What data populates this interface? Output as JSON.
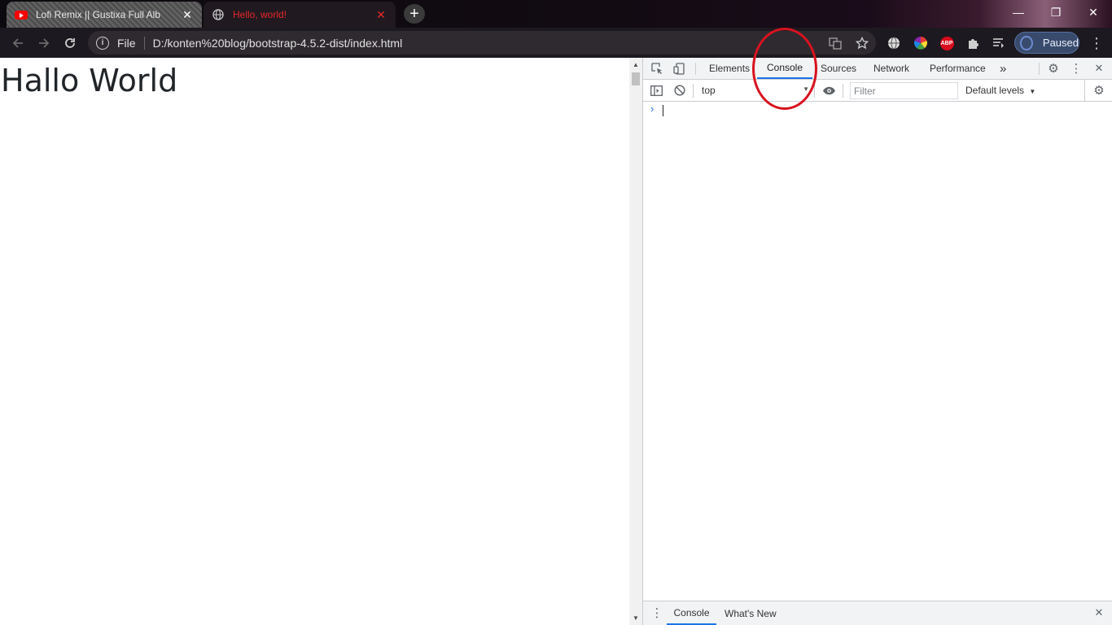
{
  "browser": {
    "tabs": [
      {
        "title": "Lofi Remix || Gustixa Full Alb",
        "favicon": "youtube-icon"
      },
      {
        "title": "Hello, world!",
        "favicon": "globe-icon"
      }
    ],
    "new_tab_label": "+",
    "window_controls": {
      "minimize": "—",
      "restore": "❐",
      "close": "✕"
    },
    "address_bar": {
      "scheme_label": "File",
      "url": "D:/konten%20blog/bootstrap-4.5.2-dist/index.html"
    },
    "profile": {
      "label": "Paused"
    },
    "extensions": [
      "translate-icon",
      "bookmark-star-icon",
      "globe-extension-icon",
      "color-wheel-icon",
      "adblock-plus-icon",
      "puzzle-icon",
      "media-queue-icon"
    ],
    "adblock_label": "ABP"
  },
  "page": {
    "heading": "Hallo World"
  },
  "devtools": {
    "tabs": [
      "Elements",
      "Console",
      "Sources",
      "Network",
      "Performance"
    ],
    "more_tabs": "»",
    "active_tab": "Console",
    "context": "top",
    "filter_placeholder": "Filter",
    "levels": "Default levels",
    "prompt": "›",
    "drawer_tabs": [
      "Console",
      "What's New"
    ]
  },
  "colors": {
    "annotation": "#d9121f",
    "active_tab_underline": "#1a73e8",
    "tab_title_red": "#e8262a"
  }
}
